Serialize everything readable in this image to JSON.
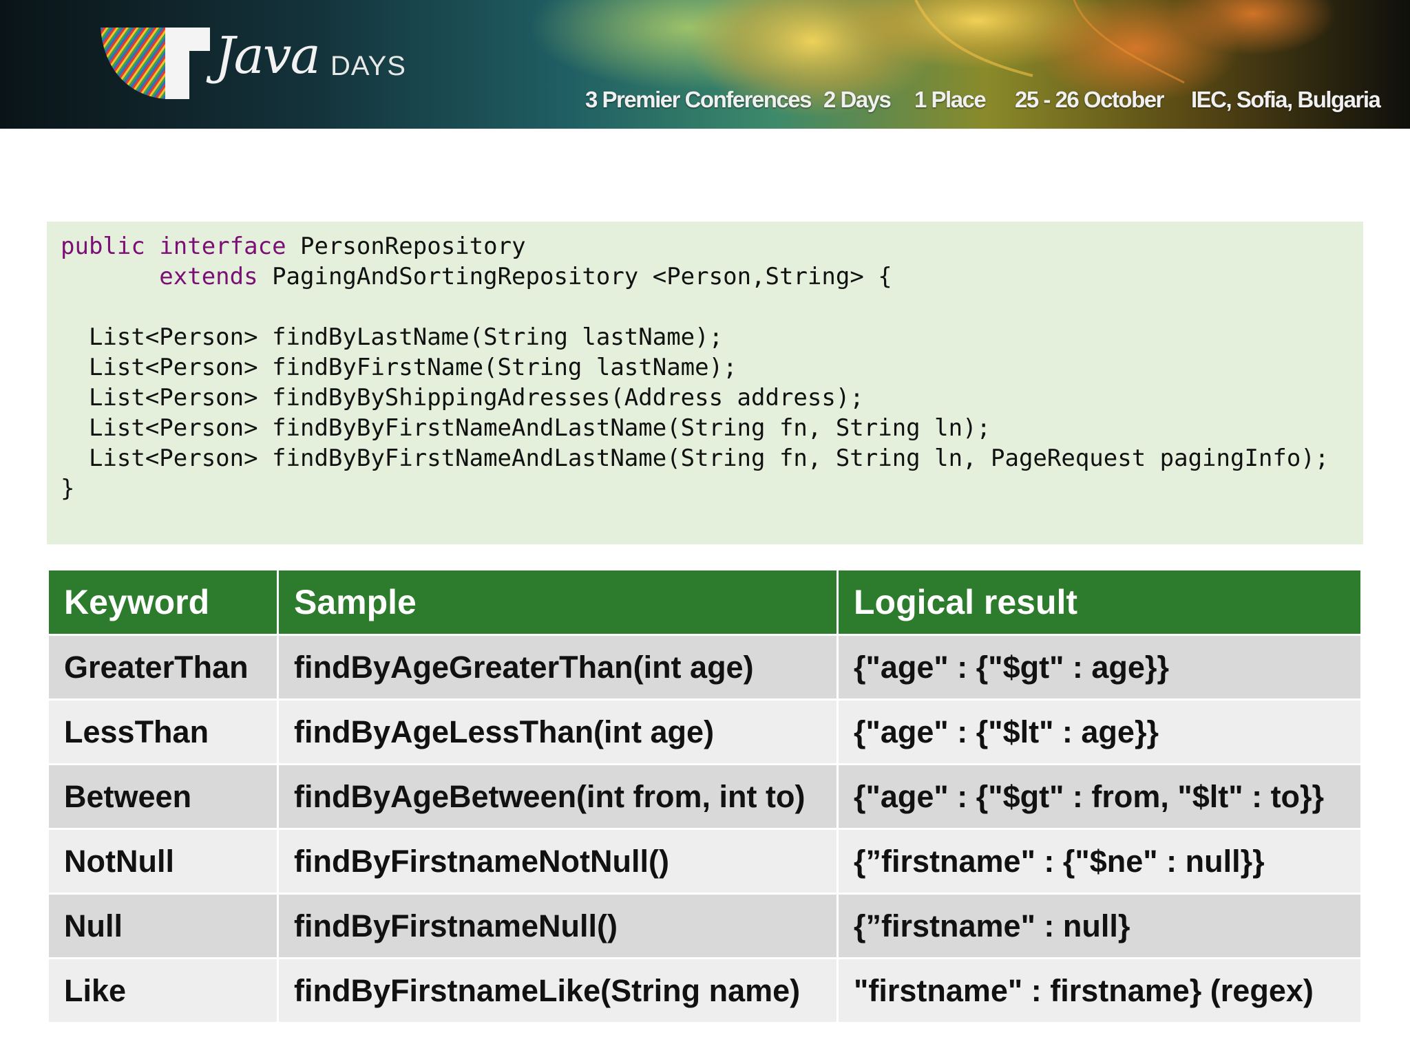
{
  "banner": {
    "logo_wordmark": "Java",
    "logo_days": "DAYS",
    "taglines": [
      "3 Premier Conferences",
      "2 Days",
      "1 Place",
      "25 - 26 October",
      "IEC, Sofia, Bulgaria"
    ]
  },
  "code": {
    "line1": {
      "kw1": "public",
      "kw2": "interface",
      "rest": " PersonRepository"
    },
    "line2": {
      "indent": "       ",
      "kw": "extends",
      "rest": " PagingAndSortingRepository <Person,String> {"
    },
    "methods": [
      "  List<Person> findByLastName(String lastName);",
      "  List<Person> findByFirstName(String lastName);",
      "  List<Person> findByByShippingAdresses(Address address);",
      "  List<Person> findByByFirstNameAndLastName(String fn, String ln);",
      "  List<Person> findByByFirstNameAndLastName(String fn, String ln, PageRequest pagingInfo);"
    ],
    "closing": "}"
  },
  "table": {
    "headers": [
      "Keyword",
      "Sample",
      "Logical result"
    ],
    "rows": [
      [
        "GreaterThan",
        "findByAgeGreaterThan(int age)",
        "{\"age\" : {\"$gt\" : age}}"
      ],
      [
        "LessThan",
        "findByAgeLessThan(int age)",
        "{\"age\" : {\"$lt\" : age}}"
      ],
      [
        "Between",
        "findByAgeBetween(int from, int to)",
        "{\"age\" : {\"$gt\" : from, \"$lt\" : to}}"
      ],
      [
        "NotNull",
        "findByFirstnameNotNull()",
        "{”firstname\" : {\"$ne\" : null}}"
      ],
      [
        "Null",
        "findByFirstnameNull()",
        "{”firstname\" : null}"
      ],
      [
        "Like",
        "findByFirstnameLike(String name)",
        "\"firstname\" : firstname} (regex)"
      ]
    ]
  },
  "colors": {
    "header_green": "#2d7b2c",
    "code_bg": "#e4f0dc",
    "keyword_purple": "#7b0f75"
  }
}
